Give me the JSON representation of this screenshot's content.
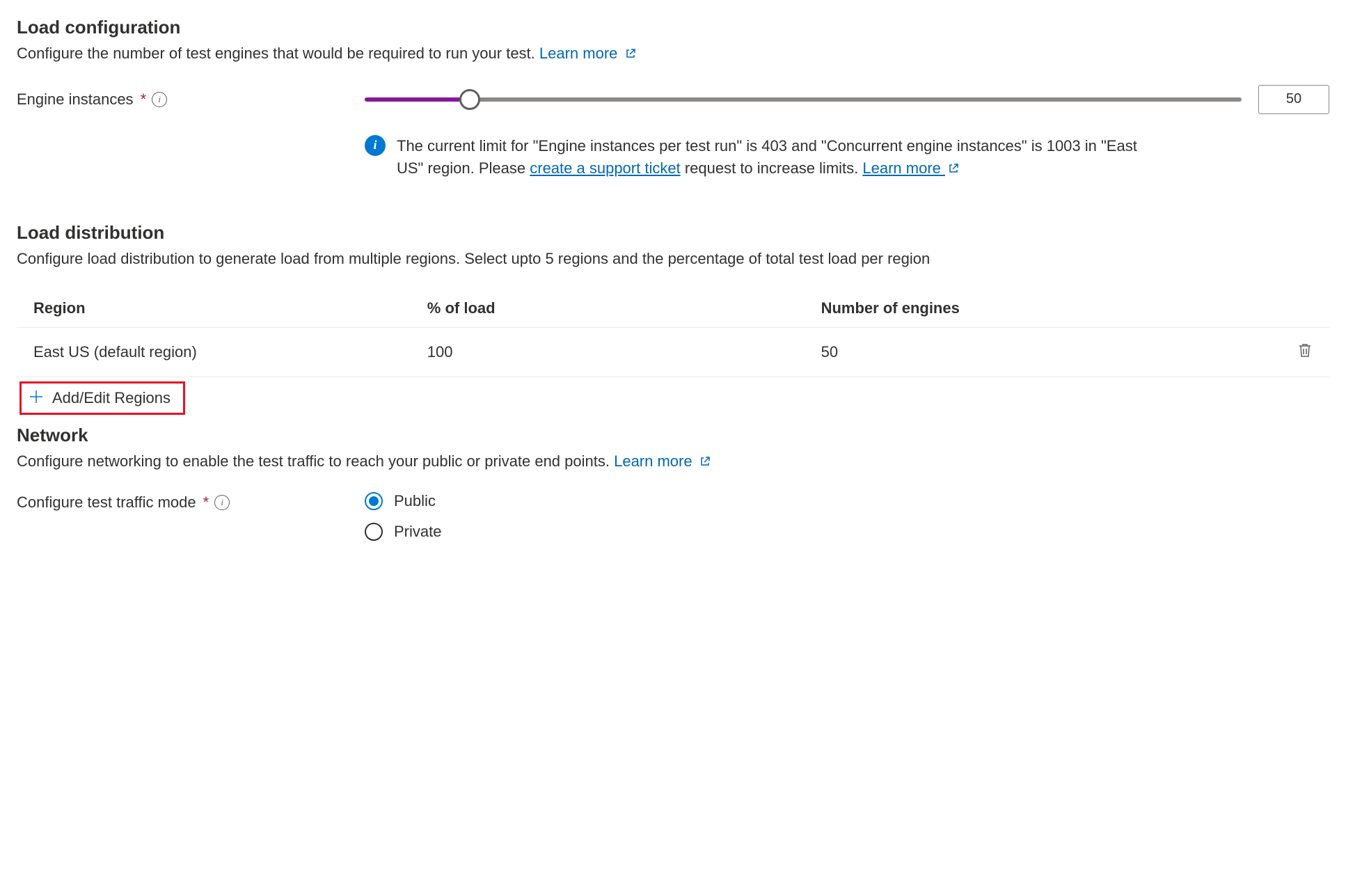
{
  "loadConfig": {
    "title": "Load configuration",
    "desc": "Configure the number of test engines that would be required to run your test. ",
    "learnMore": "Learn more",
    "engineInstancesLabel": "Engine instances",
    "engineInstancesValue": "50",
    "sliderPercent": 12,
    "infoMsg": {
      "pre": "The current limit for \"Engine instances per test run\" is 403 and \"Concurrent engine instances\" is 1003 in \"East US\" region. Please ",
      "link1": "create a support ticket",
      "mid": " request to increase limits. ",
      "link2": "Learn more"
    }
  },
  "loadDist": {
    "title": "Load distribution",
    "desc": "Configure load distribution to generate load from multiple regions. Select upto 5 regions and the percentage of total test load per region",
    "columns": {
      "region": "Region",
      "pct": "% of load",
      "engines": "Number of engines"
    },
    "row": {
      "region": "East US (default region)",
      "pct": "100",
      "engines": "50"
    },
    "addEdit": "Add/Edit Regions"
  },
  "network": {
    "title": "Network",
    "desc": "Configure networking to enable the test traffic to reach your public or private end points. ",
    "learnMore": "Learn more",
    "trafficModeLabel": "Configure test traffic mode",
    "options": {
      "public": "Public",
      "private": "Private"
    }
  }
}
